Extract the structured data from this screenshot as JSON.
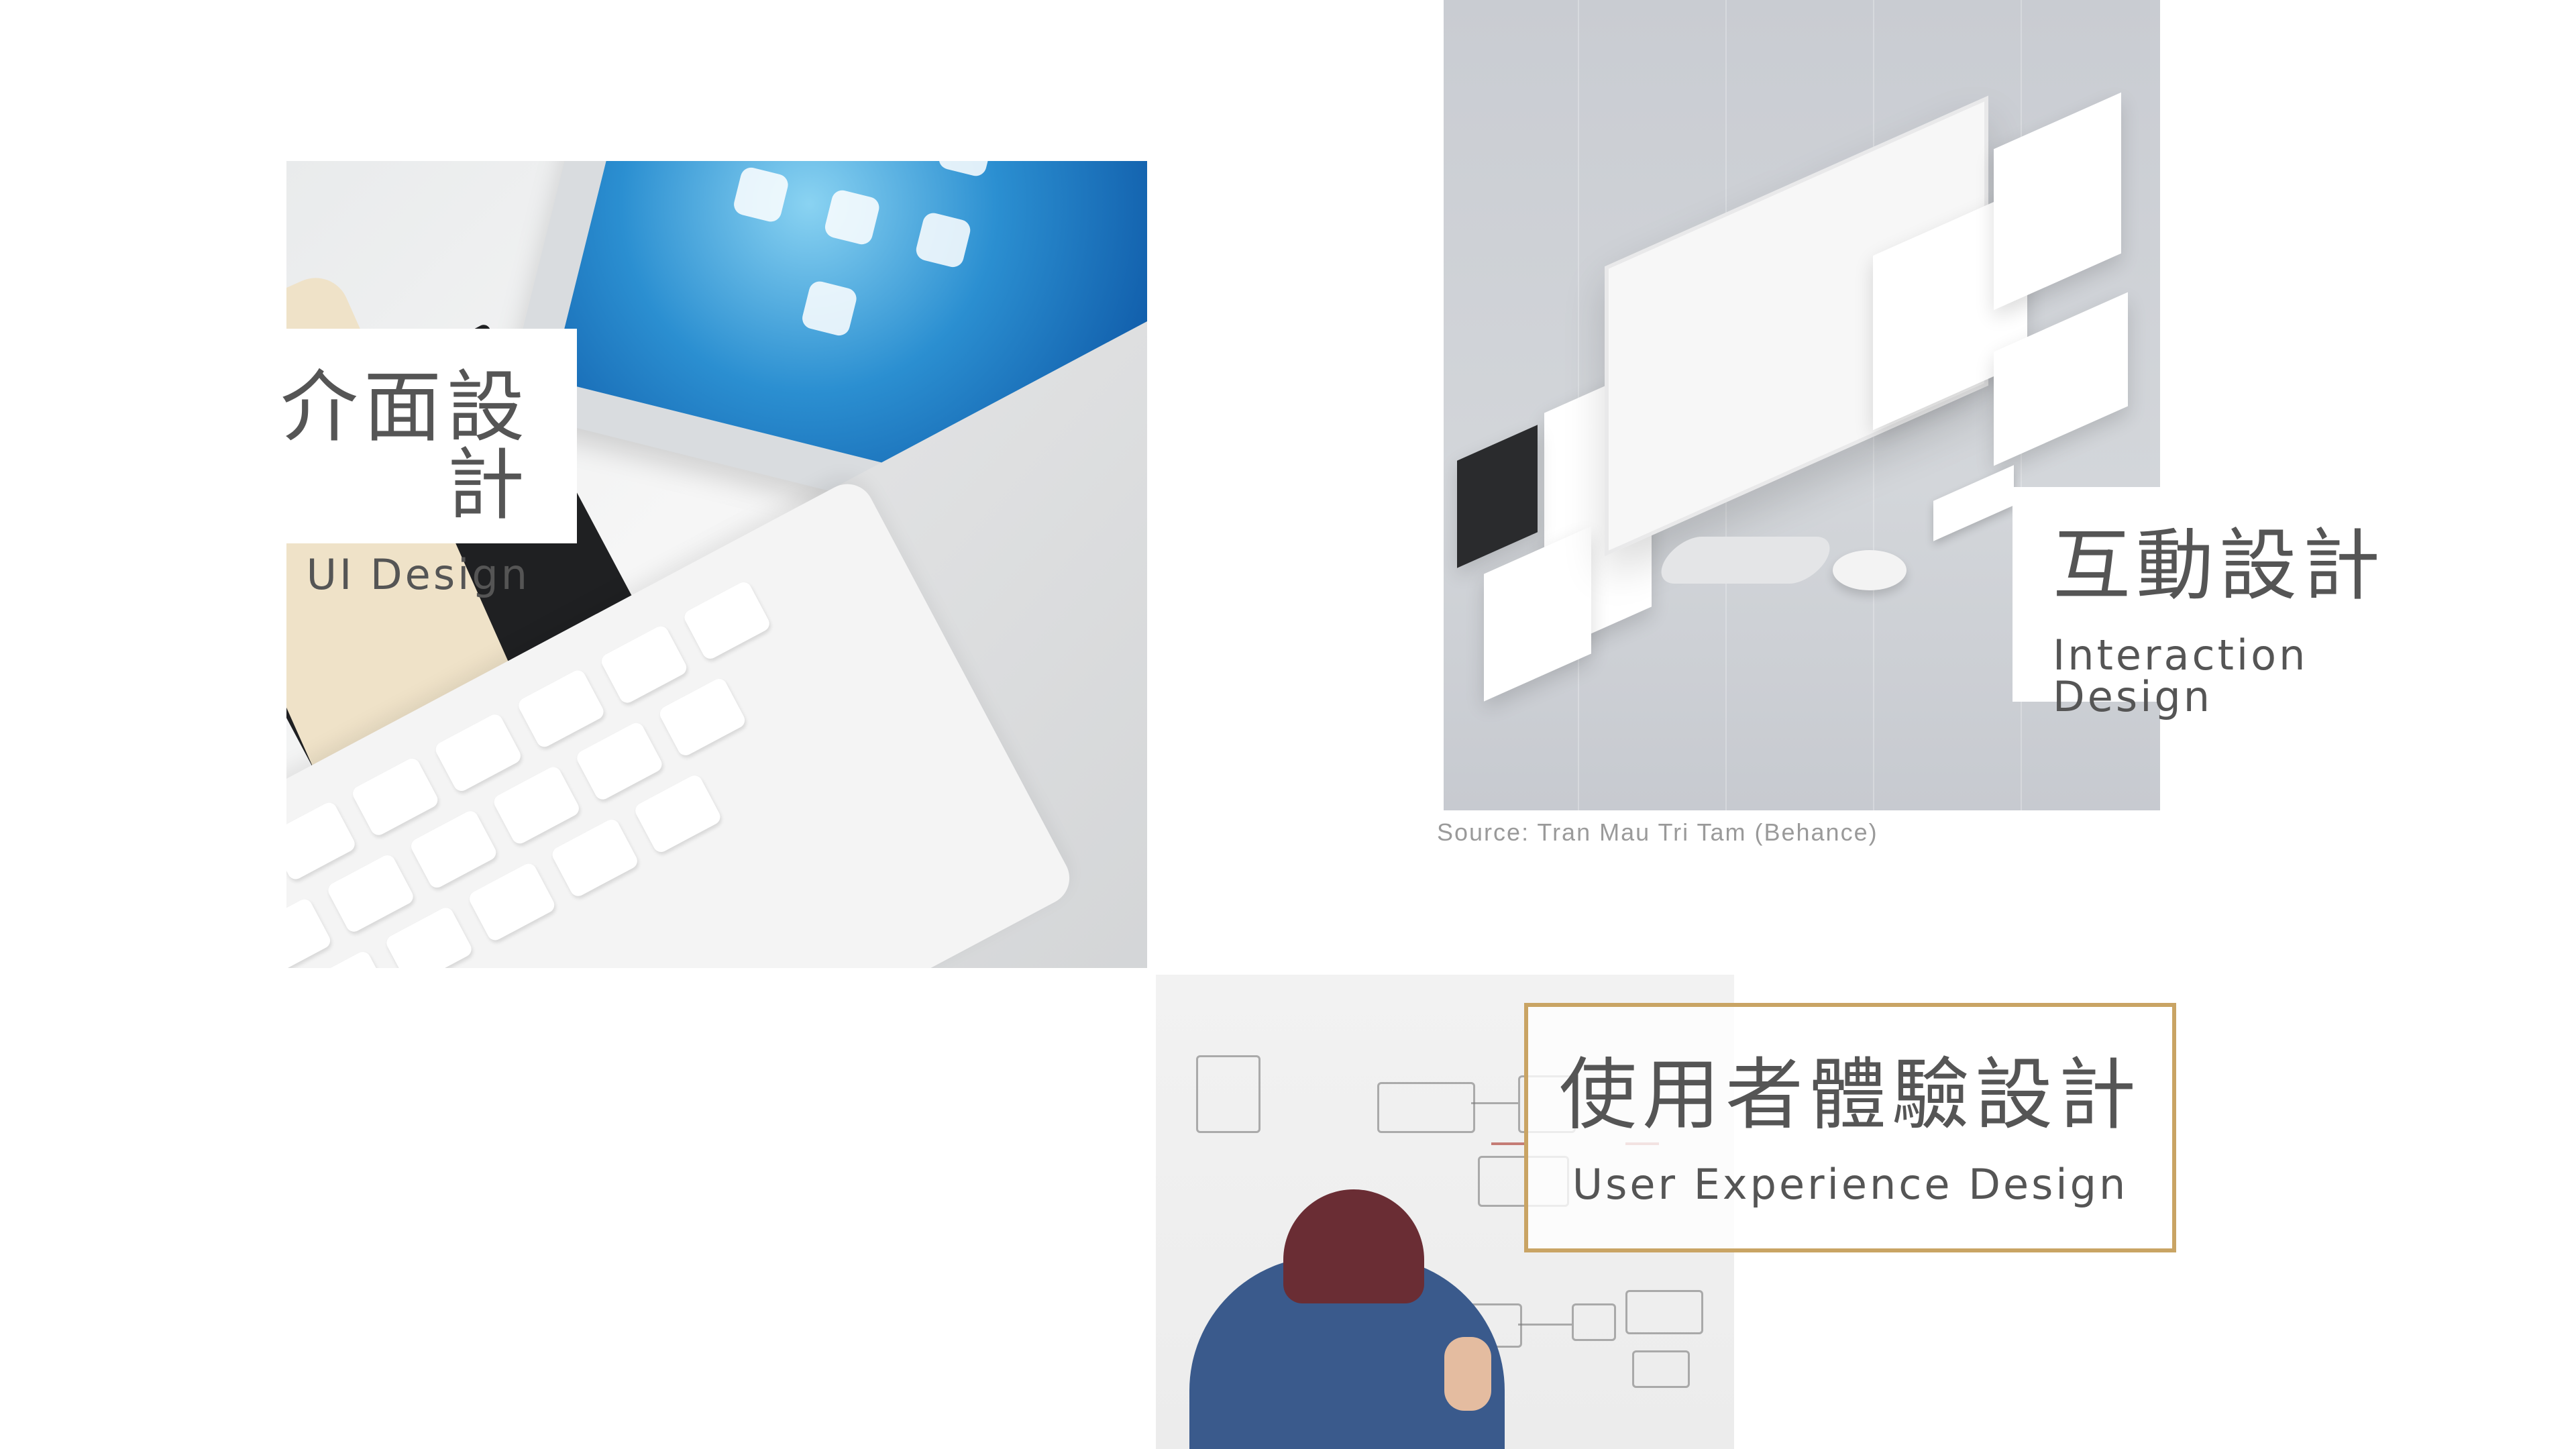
{
  "sections": {
    "ui": {
      "title_zh": "介面設計",
      "title_en": "UI Design"
    },
    "interaction": {
      "title_zh": "互動設計",
      "title_en": "Interaction Design",
      "source_caption": "Source: Tran Mau Tri Tam (Behance)"
    },
    "ux": {
      "title_zh": "使用者體驗設計",
      "title_en": "User Experience Design"
    }
  },
  "colors": {
    "text": "#555555",
    "caption": "#9a9a9a",
    "ux_border": "#c9a464",
    "background": "#ffffff"
  },
  "photos": {
    "ui": {
      "icon": "tablet-keyboard-photo"
    },
    "interaction": {
      "icon": "isometric-website-mockup-photo"
    },
    "ux": {
      "icon": "whiteboard-person-photo"
    }
  }
}
